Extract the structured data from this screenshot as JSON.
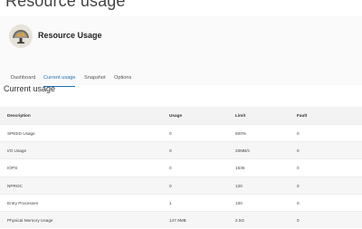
{
  "page": {
    "title": "Resource usage"
  },
  "header": {
    "app_name": "Resource Usage",
    "logo_icon": "resource-usage-logo-icon"
  },
  "tabs": [
    {
      "label": "Dashboard",
      "active": false
    },
    {
      "label": "Current usage",
      "active": true
    },
    {
      "label": "Snapshot",
      "active": false
    },
    {
      "label": "Options",
      "active": false
    }
  ],
  "section": {
    "title": "Current usage"
  },
  "table": {
    "columns": [
      "Description",
      "Usage",
      "Limit",
      "Fault"
    ],
    "rows": [
      [
        "SPEED Usage",
        "0",
        "600%",
        "0"
      ],
      [
        "I/O Usage",
        "0",
        "20MB/s",
        "0"
      ],
      [
        "IOPS",
        "0",
        "1536",
        "0"
      ],
      [
        "NPROC",
        "0",
        "120",
        "0"
      ],
      [
        "Entry Processes",
        "1",
        "100",
        "0"
      ],
      [
        "Physical Memory Usage",
        "147.9MB",
        "2.5G",
        "0"
      ]
    ]
  },
  "colors": {
    "accent": "#1e6fb5",
    "header_bg": "#fafafa",
    "row_alt": "#f6f6f6"
  }
}
